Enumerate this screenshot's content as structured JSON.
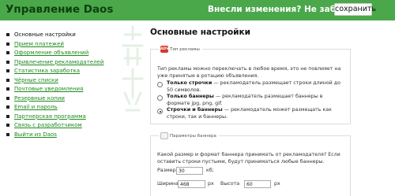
{
  "header": {
    "title": "Управление Daos",
    "notice": "Внесли изменения? Не забывайте",
    "save_label": "сохранить",
    "bar_color": "#4aa84a"
  },
  "sidebar": {
    "items": [
      {
        "label": "Основные настройки",
        "active": true
      },
      {
        "label": "Прием платежей",
        "active": false
      },
      {
        "label": "Оформление объявлений",
        "active": false
      },
      {
        "label": "Привлечение рекламодателей",
        "active": false
      },
      {
        "label": "Статистика заработка",
        "active": false
      },
      {
        "label": "Чёрные списки",
        "active": false
      },
      {
        "label": "Почтовые уведомления",
        "active": false
      },
      {
        "label": "Резервные копии",
        "active": false
      },
      {
        "label": "Email и пароль",
        "active": false
      },
      {
        "label": "Партнерская программа",
        "active": false
      },
      {
        "label": "Связь с разработчиком",
        "active": false
      },
      {
        "label": "Выйти из Daos",
        "active": false
      }
    ]
  },
  "main": {
    "title": "Основные настройки",
    "ad_type": {
      "legend": "Тип рекламы",
      "icon_text": "ADV",
      "description": "Тип рекламы можно переключать в любое время, это не повлияет на уже принятые в ротацию объявления.",
      "options": [
        {
          "title": "Только строчки",
          "desc": " — рекламодатель размещает строки длиной до 50 символов.",
          "checked": false
        },
        {
          "title": "Только баннеры",
          "desc": " — рекламодатель размещает баннеры в формате jpg, png, gif.",
          "checked": false
        },
        {
          "title": "Строчки и баннеры",
          "desc": " — рекламодатель может размещать как строки, так и баннеры.",
          "checked": true
        }
      ]
    },
    "banner_params": {
      "legend": "Параметры баннера",
      "description": "Какой размер и формат баннера принимать от рекламодателя? Если оставить строки пустыми, будут приниматься любые баннеры.",
      "size_label": "Размер",
      "size_value": "30",
      "size_unit": "кб;",
      "width_label": "Ширина",
      "width_value": "468",
      "width_unit": "px",
      "height_label": "Высота",
      "height_value": "60",
      "height_unit": "px"
    }
  }
}
